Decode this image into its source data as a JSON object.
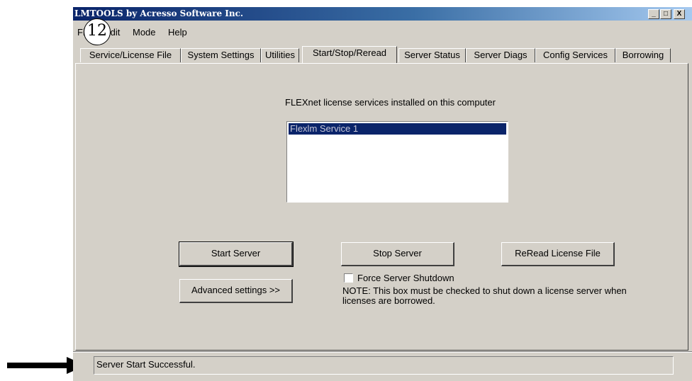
{
  "window": {
    "title": "LMTOOLS by Acresso Software Inc.",
    "controls": {
      "minimize": "_",
      "maximize": "□",
      "close": "X"
    }
  },
  "annotation": {
    "step_number": "12"
  },
  "menu": {
    "file": "File",
    "edit": "Edit",
    "mode": "Mode",
    "help": "Help"
  },
  "tabs": [
    {
      "label": "Service/License File"
    },
    {
      "label": "System Settings"
    },
    {
      "label": "Utilities"
    },
    {
      "label": "Start/Stop/Reread",
      "active": true
    },
    {
      "label": "Server Status"
    },
    {
      "label": "Server Diags"
    },
    {
      "label": "Config Services"
    },
    {
      "label": "Borrowing"
    }
  ],
  "panel": {
    "caption": "FLEXnet license services installed on this computer",
    "services": [
      "Flexlm Service 1"
    ],
    "buttons": {
      "start": "Start Server",
      "stop": "Stop Server",
      "reread": "ReRead License File",
      "advanced": "Advanced settings >>"
    },
    "force_shutdown": {
      "label": "Force Server Shutdown",
      "checked": false
    },
    "note": "NOTE:  This box must be checked to shut down a license server when licenses are borrowed."
  },
  "status": {
    "text": "Server Start Successful."
  },
  "icons": {
    "arrow": "right-arrow-icon"
  }
}
